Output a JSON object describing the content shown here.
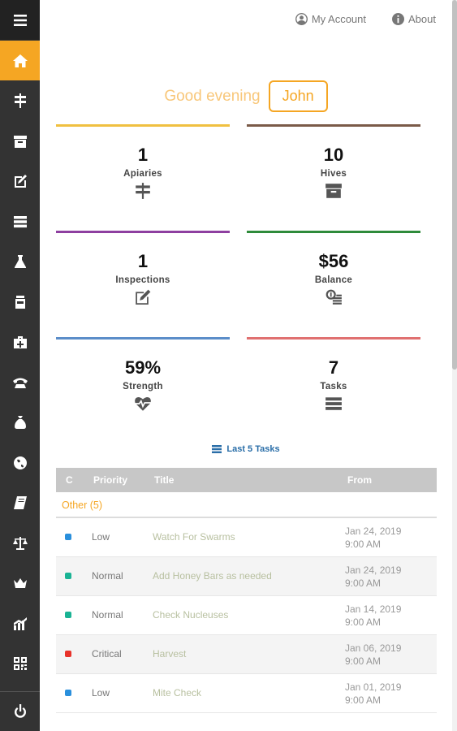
{
  "nav": {
    "my_account": "My Account",
    "about": "About"
  },
  "sidebar": {
    "items": [
      {
        "name": "menu",
        "icon": "hamburger-menu-icon"
      },
      {
        "name": "home",
        "icon": "home-icon",
        "active": true
      },
      {
        "name": "apiaries",
        "icon": "signpost-icon"
      },
      {
        "name": "hives",
        "icon": "archive-box-icon"
      },
      {
        "name": "inspections",
        "icon": "edit-icon"
      },
      {
        "name": "tasks",
        "icon": "list-icon"
      },
      {
        "name": "treatments",
        "icon": "flask-icon"
      },
      {
        "name": "feedings",
        "icon": "jar-icon"
      },
      {
        "name": "medical",
        "icon": "medkit-icon"
      },
      {
        "name": "contacts",
        "icon": "phone-icon"
      },
      {
        "name": "finance",
        "icon": "money-bag-icon"
      },
      {
        "name": "map",
        "icon": "globe-icon"
      },
      {
        "name": "journal",
        "icon": "book-icon"
      },
      {
        "name": "harvest",
        "icon": "scale-icon"
      },
      {
        "name": "queens",
        "icon": "crown-icon"
      },
      {
        "name": "reports",
        "icon": "chart-icon"
      },
      {
        "name": "qr-codes",
        "icon": "qrcode-icon"
      },
      {
        "name": "logout",
        "icon": "power-icon"
      }
    ]
  },
  "greeting": {
    "text": "Good evening",
    "name": "John"
  },
  "cards": [
    {
      "value": "1",
      "label": "Apiaries",
      "color": "#f0c040",
      "icon": "signpost-icon"
    },
    {
      "value": "10",
      "label": "Hives",
      "color": "#7a5a48",
      "icon": "archive-box-icon"
    },
    {
      "value": "1",
      "label": "Inspections",
      "color": "#8e3fa0",
      "icon": "edit-icon"
    },
    {
      "value": "$56",
      "label": "Balance",
      "color": "#2e8b3a",
      "icon": "money-icon"
    },
    {
      "value": "59%",
      "label": "Strength",
      "color": "#5b8dc9",
      "icon": "heartbeat-icon"
    },
    {
      "value": "7",
      "label": "Tasks",
      "color": "#e07070",
      "icon": "list-icon"
    }
  ],
  "tasks_section": {
    "title": "Last 5 Tasks"
  },
  "table": {
    "headers": {
      "c": "C",
      "priority": "Priority",
      "title": "Title",
      "from": "From"
    },
    "group": "Other (5)",
    "rows": [
      {
        "color": "#2a8fdc",
        "priority": "Low",
        "title": "Watch For Swarms",
        "date": "Jan 24, 2019",
        "time": "9:00 AM"
      },
      {
        "color": "#1ab394",
        "priority": "Normal",
        "title": "Add Honey Bars as needed",
        "date": "Jan 24, 2019",
        "time": "9:00 AM"
      },
      {
        "color": "#1ab394",
        "priority": "Normal",
        "title": "Check Nucleuses",
        "date": "Jan 14, 2019",
        "time": "9:00 AM"
      },
      {
        "color": "#e8322a",
        "priority": "Critical",
        "title": "Harvest",
        "date": "Jan 06, 2019",
        "time": "9:00 AM"
      },
      {
        "color": "#2a8fdc",
        "priority": "Low",
        "title": "Mite Check",
        "date": "Jan 01, 2019",
        "time": "9:00 AM"
      }
    ]
  }
}
